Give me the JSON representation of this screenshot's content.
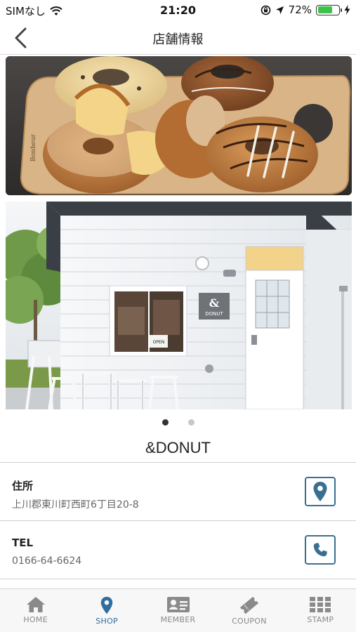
{
  "status_bar": {
    "carrier": "SIMなし",
    "time": "21:20",
    "battery_percent": "72%",
    "battery_level": 0.72,
    "battery_color": "#3cc24a"
  },
  "nav": {
    "back_icon": "chevron-left-icon",
    "title": "店舗情報"
  },
  "gallery": {
    "photos": [
      "donuts-photo",
      "storefront-photo"
    ],
    "active_index": 0,
    "storefront_sign_symbol": "&",
    "storefront_sign_text": "DONUT",
    "window_sign_text": "OPEN"
  },
  "shop": {
    "name": "&DONUT"
  },
  "info": {
    "address": {
      "label": "住所",
      "value": "上川郡東川町西町6丁目20-8",
      "icon": "map-pin-icon"
    },
    "tel": {
      "label": "TEL",
      "value": "0166-64-6624",
      "icon": "phone-icon"
    }
  },
  "tabs": [
    {
      "label": "HOME",
      "icon": "home-icon"
    },
    {
      "label": "SHOP",
      "icon": "map-pin-icon"
    },
    {
      "label": "MEMBER",
      "icon": "member-card-icon"
    },
    {
      "label": "COUPON",
      "icon": "coupon-ticket-icon"
    },
    {
      "label": "STAMP",
      "icon": "stamp-grid-icon"
    }
  ],
  "colors": {
    "accent": "#2f6ea0",
    "icon_border": "#3b6f91",
    "inactive_tab": "#8a8a8a"
  }
}
